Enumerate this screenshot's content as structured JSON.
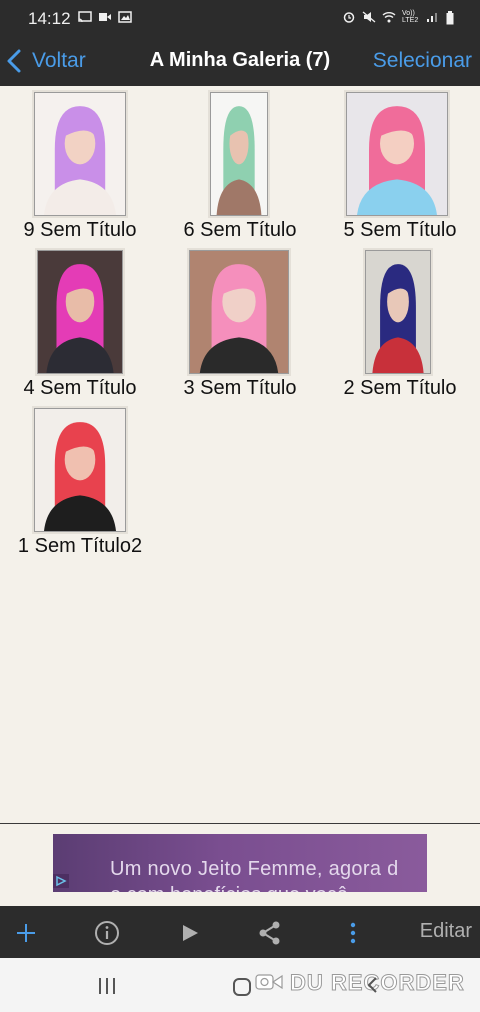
{
  "status_bar": {
    "time": "14:12",
    "left_icons": [
      "cast-icon",
      "video-camera-icon",
      "image-icon"
    ],
    "right_icons": [
      "alarm-icon",
      "mute-icon",
      "wifi-icon",
      "volte-icon",
      "signal-icon",
      "battery-icon"
    ],
    "volte_label": "Vo)) LTE2"
  },
  "nav": {
    "back_label": "Voltar",
    "title": "A Minha Galeria (7)",
    "select_label": "Selecionar"
  },
  "gallery": {
    "items": [
      {
        "label": "9 Sem Título",
        "hair": "#c98fe8",
        "skin": "#f2d2c4",
        "bg": "#f5f1ee",
        "shirt": "#f3ece8"
      },
      {
        "label": "6 Sem Título",
        "hair": "#8fd0b0",
        "skin": "#e8c2b0",
        "bg": "#f6f6f4",
        "shirt": "#a07868"
      },
      {
        "label": "5 Sem Título",
        "hair": "#f06c9a",
        "skin": "#f4cfc2",
        "bg": "#e8e6ea",
        "shirt": "#8ad0ee"
      },
      {
        "label": "4 Sem Título",
        "hair": "#e43cb6",
        "skin": "#e8bca8",
        "bg": "#4a3a3a",
        "shirt": "#2c2c34"
      },
      {
        "label": "3 Sem Título",
        "hair": "#f58fbc",
        "skin": "#f0d0c8",
        "bg": "#b08470",
        "shirt": "#2a2a2a"
      },
      {
        "label": "2 Sem Título",
        "hair": "#2a2a80",
        "skin": "#e8c8b8",
        "bg": "#d8d6d0",
        "shirt": "#c8303a"
      },
      {
        "label": "1 Sem Título2",
        "hair": "#e8424e",
        "skin": "#f0c0b0",
        "bg": "#f2eeea",
        "shirt": "#1e1e1e"
      }
    ]
  },
  "ad": {
    "line1": "Um novo Jeito Femme, agora d",
    "line2": "e com benefícios que você",
    "colors": {
      "background": "#6f4787",
      "text": "#e4d8ec"
    }
  },
  "toolbar": {
    "buttons": [
      "add-icon",
      "info-icon",
      "play-icon",
      "share-icon",
      "more-vertical-icon"
    ],
    "edit_label": "Editar",
    "accent": "#4a9ce8"
  },
  "system_nav": {
    "watermark": "DU RECORDER"
  },
  "colors": {
    "accent": "#4a9ce8",
    "bar_background": "#2c2c2c",
    "content_background": "#f4f1ea"
  }
}
